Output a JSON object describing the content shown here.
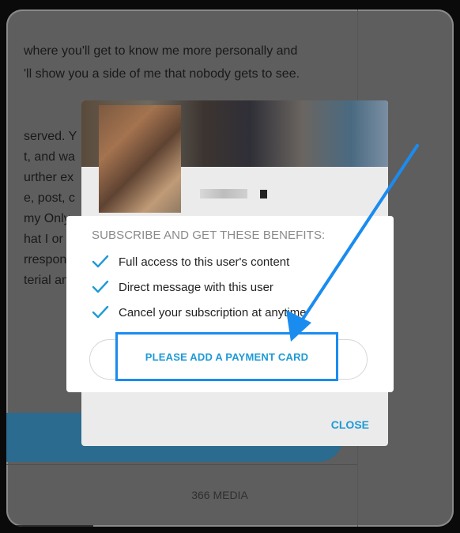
{
  "background": {
    "intro_lines": [
      "where you'll get to know me more personally and",
      "'ll show you a side of me that nobody gets to see."
    ],
    "fragments": [
      "served. Y",
      "t, and wa",
      "urther ex",
      "e, post, c",
      "my Only",
      "hat I or n",
      "rrespond",
      "terial an"
    ],
    "media_tab": "366 MEDIA"
  },
  "modal": {
    "benefits_title": "SUBSCRIBE AND GET THESE BENEFITS:",
    "benefits": [
      "Full access to this user's content",
      "Direct message with this user",
      "Cancel your subscription at anytime"
    ],
    "payment_button": "PLEASE ADD A PAYMENT CARD",
    "close_button": "CLOSE"
  },
  "colors": {
    "accent": "#1e9ad6",
    "highlight_border": "#1a8cf0",
    "annotation_arrow": "#1a8cf0"
  },
  "icons": {
    "check": "check-icon",
    "arrow": "annotation-arrow-icon"
  }
}
